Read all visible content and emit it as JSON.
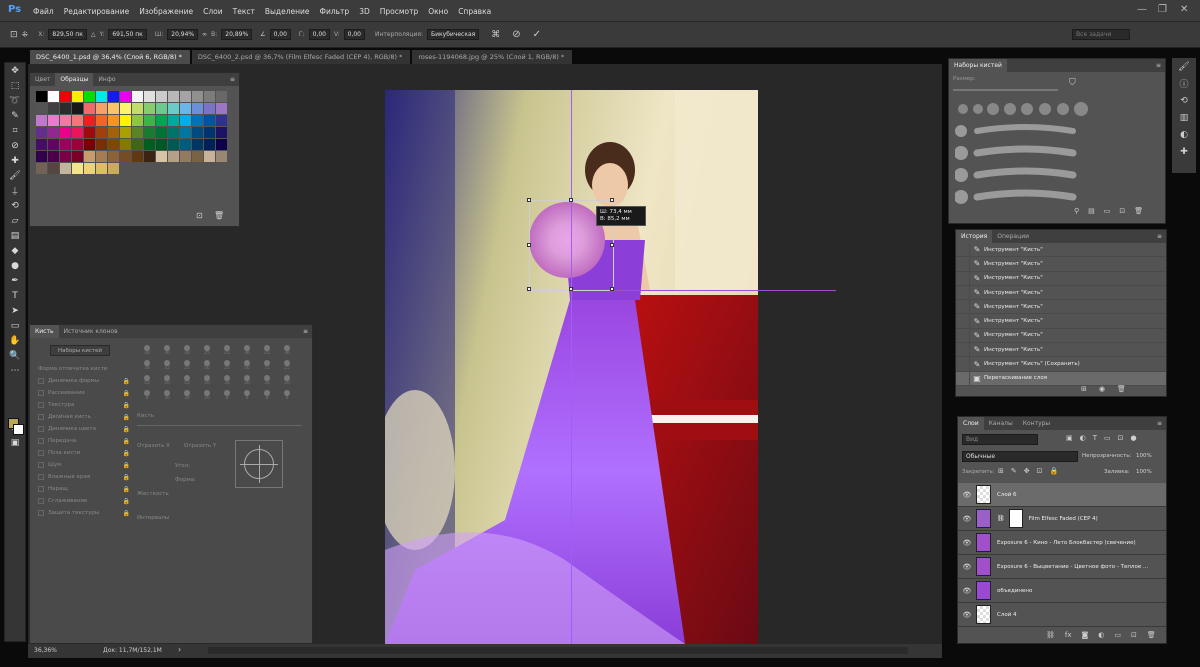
{
  "app": {
    "logo": "Ps",
    "menus": [
      "Файл",
      "Редактирование",
      "Изображение",
      "Слои",
      "Текст",
      "Выделение",
      "Фильтр",
      "3D",
      "Просмотр",
      "Окно",
      "Справка"
    ]
  },
  "options": {
    "x": "829,50 пк",
    "w": "20,94%",
    "y": "691,50 пк",
    "h": "20,89%",
    "angle": "0,00",
    "hskew": "0,00",
    "vskew": "0,00",
    "interp_label": "Интерполяция:",
    "interp": "Бикубическая",
    "search_placeholder": "Все задачи"
  },
  "tabs": [
    "DSC_6400_1.psd @ 36,4% (Слой 6, RGB/8) *",
    "DSC_6400_2.psd @ 36,7% (Film Elfesc Faded (СЕР 4), RGB/8) *",
    "roses-1194068.jpg @ 25% (Слой 1, RGB/8) *"
  ],
  "swatches_panel": {
    "tabs": [
      "Цвет",
      "Образцы",
      "Инфо"
    ],
    "colors": [
      "#000000",
      "#ffffff",
      "#f20000",
      "#ffee00",
      "#00e000",
      "#00e8e8",
      "#1a18f0",
      "#ee00ee",
      "#f4f4f4",
      "#e0e0e0",
      "#cccccc",
      "#b8b8b8",
      "#a4a4a4",
      "#909090",
      "#7c7c7c",
      "#686868",
      "#545454",
      "#404040",
      "#2c2c2c",
      "#181818",
      "#f36868",
      "#f6a06a",
      "#f9c46a",
      "#fdf36c",
      "#c3dd6d",
      "#85cd6d",
      "#6bc98e",
      "#6acbc8",
      "#6ab6e8",
      "#6c8fd8",
      "#7b74c6",
      "#9b75c6",
      "#c078c8",
      "#ec7ac8",
      "#f07aa2",
      "#f2767a",
      "#ee1c24",
      "#f26522",
      "#f7941d",
      "#fff200",
      "#8dc63f",
      "#39b54a",
      "#00a651",
      "#00a99d",
      "#00aeef",
      "#0072bc",
      "#0054a6",
      "#2e3192",
      "#662d91",
      "#92278f",
      "#ec008c",
      "#ed145b",
      "#9e0b0f",
      "#a0410d",
      "#a36209",
      "#aba000",
      "#598527",
      "#197b30",
      "#007236",
      "#00746b",
      "#0076a3",
      "#004a80",
      "#003471",
      "#1b1464",
      "#440e62",
      "#630460",
      "#9e005d",
      "#9e0039",
      "#790000",
      "#7b2e00",
      "#7d4900",
      "#827b00",
      "#406618",
      "#005e20",
      "#005826",
      "#005952",
      "#005b7f",
      "#003663",
      "#002157",
      "#0d004c",
      "#32004b",
      "#4b0049",
      "#7b0046",
      "#7a0026",
      "#c69c6d",
      "#a67c52",
      "#8c6239",
      "#754c24",
      "#603913",
      "#3c2415",
      "#d9c3a5",
      "#b4a086",
      "#917a5f",
      "#7a6244",
      "#c7b299",
      "#998675",
      "#736357",
      "#534741",
      "#c2b59b",
      "#f4e38a",
      "#ecd37a",
      "#d8bf64",
      "#c9ab5e"
    ],
    "swatch_count": 109
  },
  "brush_panel": {
    "tabs": [
      "Кисть",
      "Источник клонов"
    ],
    "preset_button": "Наборы кистей",
    "options": [
      "Форма отпечатка кисти",
      "Динамика формы",
      "Рассеивание",
      "Текстура",
      "Двойная кисть",
      "Динамика цвета",
      "Передача",
      "Поза кисти",
      "Шум",
      "Влажные края",
      "Наращ.",
      "Сглаживание",
      "Защита текстуры"
    ],
    "tips": [
      "30",
      "30",
      "30",
      "25",
      "25",
      "36",
      "25",
      "36",
      "36",
      "32",
      "25",
      "50",
      "25",
      "50",
      "71",
      "25",
      "50",
      "50",
      "50",
      "50",
      "36",
      "30",
      "30",
      "20",
      "9",
      "30",
      "30",
      "20",
      "9",
      "9",
      "9",
      "9"
    ],
    "size_label": "Кисть",
    "flipx": "Отразить Х",
    "flipy": "Отразить Y",
    "angle": "Угол:",
    "form": "Форма:",
    "hardness": "Жесткость",
    "interval": "Интервалы"
  },
  "infotip": {
    "w": "Ш: 73,4 мм",
    "h": "В: 85,2 мм"
  },
  "status": {
    "zoom": "36,36%",
    "doc": "Док: 11,7М/152,1М"
  },
  "brushsets_panel": {
    "title": "Наборы кистей",
    "size_label": "Размер:"
  },
  "history_panel": {
    "tabs": [
      "История",
      "Операции"
    ],
    "items": [
      "Инструмент \"Кисть\"",
      "Инструмент \"Кисть\"",
      "Инструмент \"Кисть\"",
      "Инструмент \"Кисть\"",
      "Инструмент \"Кисть\"",
      "Инструмент \"Кисть\"",
      "Инструмент \"Кисть\"",
      "Инструмент \"Кисть\"",
      "Инструмент \"Кисть\" (Сохранить)",
      "Перетаскивание слоя"
    ]
  },
  "layers_panel": {
    "tabs": [
      "Слои",
      "Каналы",
      "Контуры"
    ],
    "search_placeholder": "Вид",
    "blend": "Обычные",
    "opacity_label": "Непрозрачность:",
    "opacity": "100%",
    "lock_label": "Закрепить:",
    "fill_label": "Заливка:",
    "fill": "100%",
    "layers": [
      "Слой 6",
      "Film Elfesc Faded (СЕР 4)",
      "Exposure 6 - Кино - Лето Блокбастер (свечение)",
      "Exposure 6 - Выцветание - Цветное фото - Теплое ...",
      "объединено",
      "Слой 4"
    ]
  }
}
